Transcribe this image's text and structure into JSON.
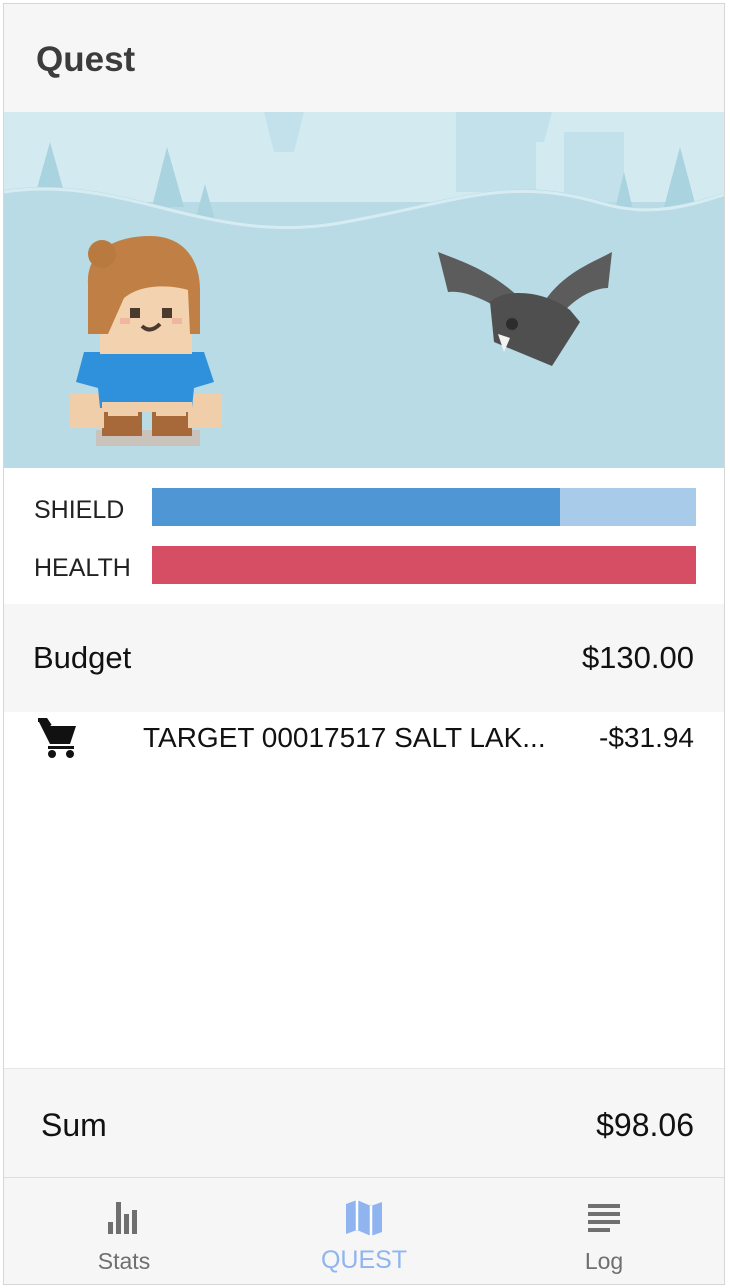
{
  "app": {
    "title": "Quest"
  },
  "stats": {
    "shield": {
      "label": "SHIELD",
      "level_percent": 75,
      "color": "#4f96d5",
      "track_color": "#a8cbea"
    },
    "health": {
      "label": "HEALTH",
      "level_percent": 100,
      "color": "#d54e64",
      "track_color": "#f1b3bd"
    }
  },
  "budget": {
    "label": "Budget",
    "amount": "$130.00"
  },
  "transactions": [
    {
      "icon": "shopping-cart-icon",
      "merchant": "TARGET 00017517 SALT LAK...",
      "amount": "-$31.94"
    }
  ],
  "sum": {
    "label": "Sum",
    "amount": "$98.06"
  },
  "nav": {
    "items": [
      {
        "label": "Stats",
        "icon": "bar-chart-icon",
        "active": false
      },
      {
        "label": "QUEST",
        "icon": "map-icon",
        "active": true
      },
      {
        "label": "Log",
        "icon": "list-icon",
        "active": false
      }
    ],
    "active_color": "#8fb4f0",
    "inactive_color": "#6f6f6f"
  }
}
